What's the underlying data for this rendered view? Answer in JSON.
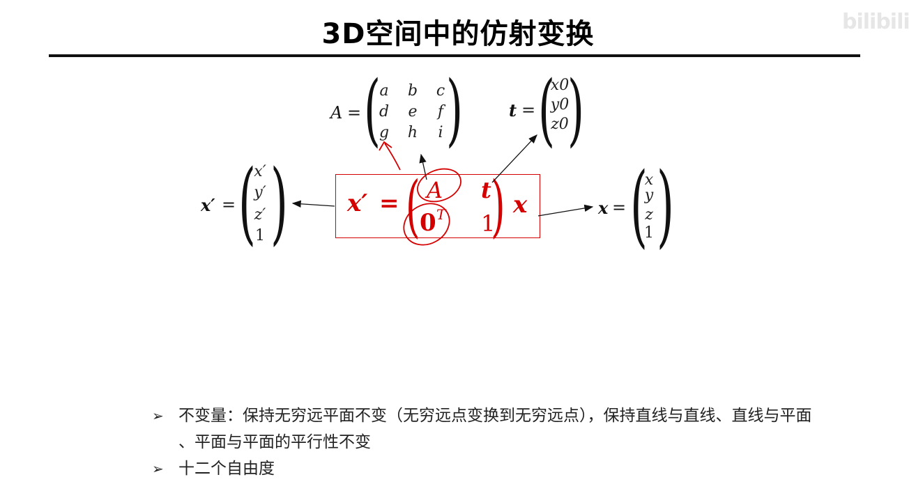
{
  "slide": {
    "title": "3D空间中的仿射变换",
    "watermark": "bilibili"
  },
  "matrix_A": {
    "label": "A",
    "equals": "=",
    "cells": [
      "a",
      "b",
      "c",
      "d",
      "e",
      "f",
      "g",
      "h",
      "i"
    ]
  },
  "vector_t": {
    "label": "t",
    "equals": "=",
    "cells": [
      "x0",
      "y0",
      "z0"
    ]
  },
  "vector_xp": {
    "label": "x′",
    "equals": "=",
    "cells": [
      "x′",
      "y′",
      "z′",
      "1"
    ]
  },
  "vector_x": {
    "label": "x",
    "equals": "=",
    "cells": [
      "x",
      "y",
      "z",
      "1"
    ]
  },
  "main_equation": {
    "lhs": "x′",
    "equals": "=",
    "A": "A",
    "t": "t",
    "zero": "0",
    "zero_sup": "T",
    "one": "1",
    "rhs": "x"
  },
  "colors": {
    "accent_red": "#d40000",
    "text": "#111111"
  },
  "bullets": [
    {
      "marker": "➢",
      "text": "不变量：保持无穷远平面不变（无穷远点变换到无穷远点），保持直线与直线、直线与平面",
      "continuation": "、平面与平面的平行性不变"
    },
    {
      "marker": "➢",
      "text": "十二个自由度"
    }
  ]
}
